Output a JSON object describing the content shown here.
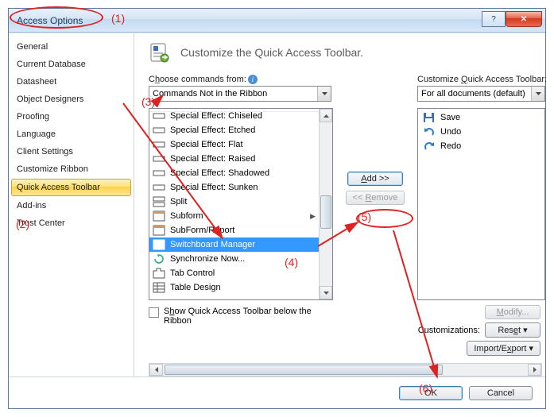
{
  "title": "Access Options",
  "header": "Customize the Quick Access Toolbar.",
  "sideItems": [
    {
      "label": "General",
      "selected": false
    },
    {
      "label": "Current Database",
      "selected": false
    },
    {
      "label": "Datasheet",
      "selected": false
    },
    {
      "label": "Object Designers",
      "selected": false
    },
    {
      "label": "Proofing",
      "selected": false
    },
    {
      "label": "Language",
      "selected": false
    },
    {
      "label": "Client Settings",
      "selected": false
    },
    {
      "label": "Customize Ribbon",
      "selected": false
    },
    {
      "label": "Quick Access Toolbar",
      "selected": true
    },
    {
      "label": "Add-ins",
      "selected": false
    },
    {
      "label": "Trust Center",
      "selected": false
    }
  ],
  "chooseCommandsLabel": "Choose commands from:",
  "chooseCommandsValue": "Commands Not in the Ribbon",
  "commandList": [
    {
      "label": "Special Effect: Chiseled",
      "icon": "rect",
      "arrow": false
    },
    {
      "label": "Special Effect: Etched",
      "icon": "rect",
      "arrow": false
    },
    {
      "label": "Special Effect: Flat",
      "icon": "rect",
      "arrow": false
    },
    {
      "label": "Special Effect: Raised",
      "icon": "rect",
      "arrow": false
    },
    {
      "label": "Special Effect: Shadowed",
      "icon": "rect",
      "arrow": false
    },
    {
      "label": "Special Effect: Sunken",
      "icon": "rect",
      "arrow": false
    },
    {
      "label": "Split",
      "icon": "split",
      "arrow": false
    },
    {
      "label": "Subform",
      "icon": "form",
      "arrow": true
    },
    {
      "label": "SubForm/Report",
      "icon": "form",
      "arrow": false
    },
    {
      "label": "Switchboard Manager",
      "icon": "switch",
      "arrow": false,
      "selected": true
    },
    {
      "label": "Synchronize Now...",
      "icon": "sync",
      "arrow": false
    },
    {
      "label": "Tab Control",
      "icon": "tab",
      "arrow": false
    },
    {
      "label": "Table Design",
      "icon": "grid",
      "arrow": false
    }
  ],
  "addLabel": "Add >>",
  "removeLabel": "<< Remove",
  "customizeQATLabel": "Customize Quick Access Toolbar:",
  "customizeQATValue": "For all documents (default)",
  "qatList": [
    {
      "label": "Save",
      "icon": "save"
    },
    {
      "label": "Undo",
      "icon": "undo"
    },
    {
      "label": "Redo",
      "icon": "redo"
    }
  ],
  "modifyLabel": "Modify...",
  "customizationsLabel": "Customizations:",
  "resetLabel": "Reset ▾",
  "importExportLabel": "Import/Export ▾",
  "showBelowLabel": "Show Quick Access Toolbar below the Ribbon",
  "okLabel": "OK",
  "cancelLabel": "Cancel",
  "annotations": {
    "n1": "(1)",
    "n2": "(2)",
    "n3": "(3)",
    "n4": "(4)",
    "n5": "(5)",
    "n6": "(6)"
  }
}
